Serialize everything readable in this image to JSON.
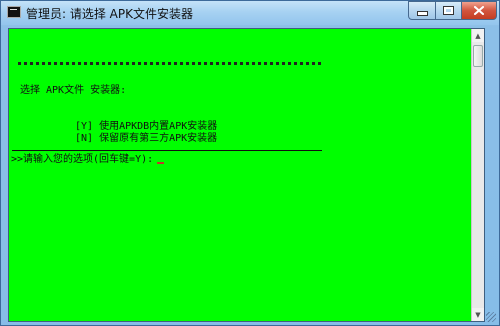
{
  "window": {
    "title": "管理员:  请选择 APK文件安装器",
    "icons": {
      "app": "console-icon",
      "minimize": "minimize-icon",
      "maximize": "maximize-icon",
      "close": "close-icon"
    }
  },
  "console": {
    "heading": "选择 APK文件 安装器:",
    "option_1": "[Y] 使用APKDB内置APK安装器",
    "option_2": "[N] 保留原有第三方APK安装器",
    "input_prompt": ">>请输入您的选项(回车键=Y):"
  },
  "scrollbar": {
    "up_icon": "scroll-up-arrow-icon",
    "down_icon": "scroll-down-arrow-icon"
  },
  "colors": {
    "console_background": "#00ff00",
    "console_text": "#111111",
    "close_button": "#c43d22"
  }
}
